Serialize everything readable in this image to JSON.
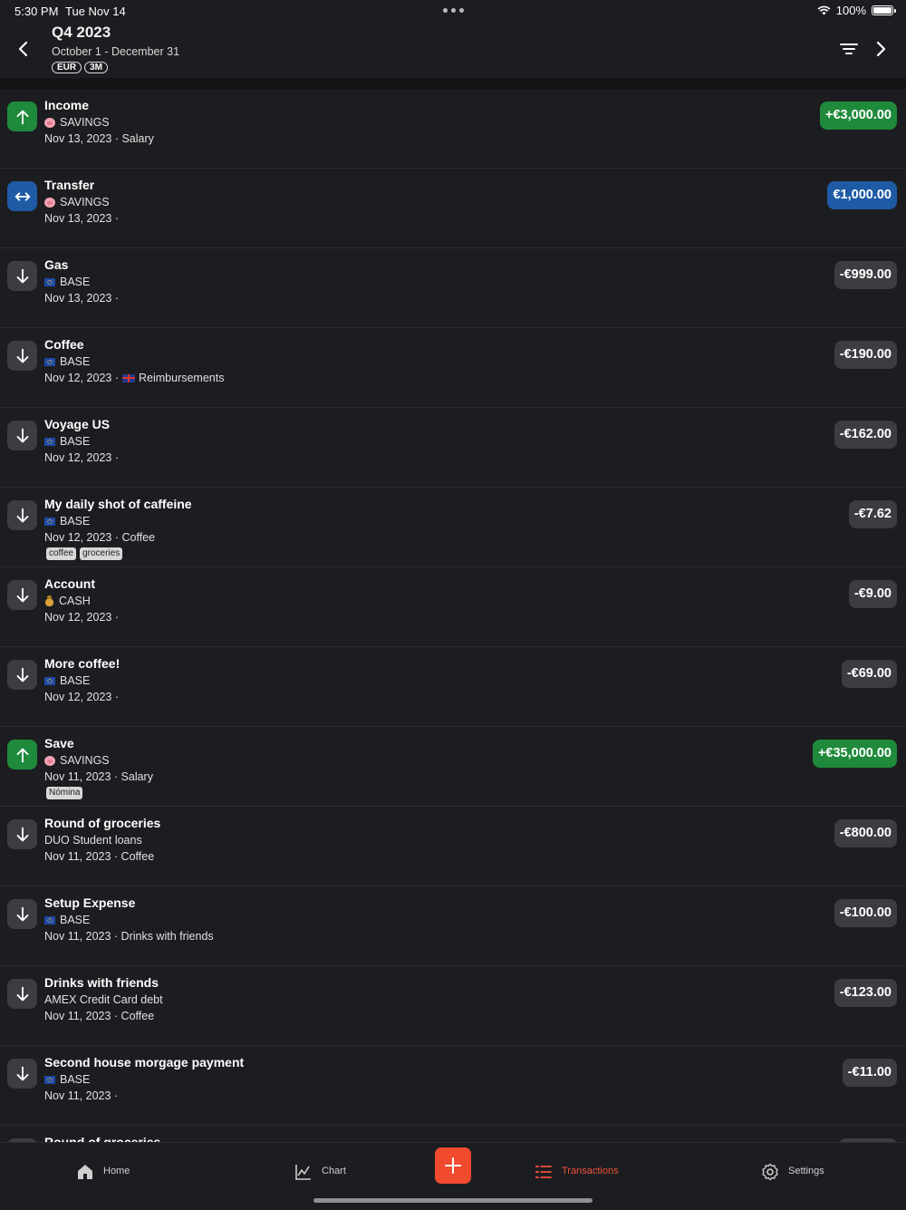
{
  "status_bar": {
    "time": "5:30 PM",
    "date": "Tue Nov 14",
    "battery": "100%"
  },
  "header": {
    "title": "Q4 2023",
    "subtitle": "October 1 - December 31",
    "chip_currency": "EUR",
    "chip_range": "3M"
  },
  "transactions": [
    {
      "type": "income",
      "name": "Income",
      "account_icon": "pig",
      "account": "SAVINGS",
      "meta": "Nov 13, 2023 · Salary",
      "amount": "+€3,000.00"
    },
    {
      "type": "transfer",
      "name": "Transfer",
      "account_icon": "pig",
      "account": "SAVINGS",
      "meta": "Nov 13, 2023 ·",
      "amount": "€1,000.00"
    },
    {
      "type": "expense",
      "name": "Gas",
      "account_icon": "eu-flag",
      "account": "BASE",
      "meta": "Nov 13, 2023 ·",
      "amount": "-€999.00"
    },
    {
      "type": "expense",
      "name": "Coffee",
      "account_icon": "eu-flag",
      "account": "BASE",
      "meta": "Nov 12, 2023 ·",
      "meta_extra": "Reimbursements",
      "amount": "-€190.00"
    },
    {
      "type": "expense",
      "name": "Voyage US",
      "account_icon": "eu-flag",
      "account": "BASE",
      "meta": "Nov 12, 2023 ·",
      "amount": "-€162.00"
    },
    {
      "type": "expense",
      "name": "My daily shot of caffeine",
      "account_icon": "eu-flag",
      "account": "BASE",
      "meta": "Nov 12, 2023 · Coffee",
      "tags": [
        "coffee",
        "groceries"
      ],
      "amount": "-€7.62"
    },
    {
      "type": "expense",
      "name": "Account",
      "account_icon": "money-bag",
      "account": "CASH",
      "meta": "Nov 12, 2023 ·",
      "amount": "-€9.00"
    },
    {
      "type": "expense",
      "name": "More coffee!",
      "account_icon": "eu-flag",
      "account": "BASE",
      "meta": "Nov 12, 2023 ·",
      "amount": "-€69.00"
    },
    {
      "type": "income",
      "name": "Save",
      "account_icon": "pig",
      "account": "SAVINGS",
      "meta": "Nov 11, 2023 · Salary",
      "tags": [
        "Nómina"
      ],
      "amount": "+€35,000.00"
    },
    {
      "type": "expense",
      "name": "Round of groceries",
      "account_icon": "",
      "account": "DUO Student loans",
      "meta": "Nov 11, 2023 · Coffee",
      "amount": "-€800.00"
    },
    {
      "type": "expense",
      "name": "Setup Expense",
      "account_icon": "eu-flag",
      "account": "BASE",
      "meta": "Nov 11, 2023 · Drinks with friends",
      "amount": "-€100.00"
    },
    {
      "type": "expense",
      "name": "Drinks with friends",
      "account_icon": "",
      "account": "AMEX Credit Card debt",
      "meta": "Nov 11, 2023 · Coffee",
      "amount": "-€123.00"
    },
    {
      "type": "expense",
      "name": "Second house morgage payment",
      "account_icon": "eu-flag",
      "account": "BASE",
      "meta": "Nov 11, 2023 ·",
      "amount": "-€11.00"
    },
    {
      "type": "expense",
      "name": "Round of groceries",
      "account_icon": "",
      "account": "",
      "meta": "",
      "amount": ""
    }
  ],
  "tabbar": {
    "home": "Home",
    "chart": "Chart",
    "transactions": "Transactions",
    "settings": "Settings",
    "accent_color": "#f04a2f"
  }
}
